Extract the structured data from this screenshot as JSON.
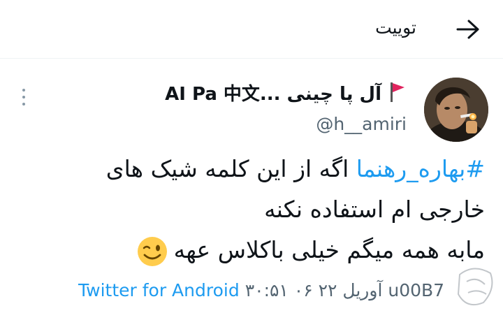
{
  "header": {
    "title": "توییت",
    "back_icon": "arrow-left-icon"
  },
  "tweet": {
    "author": {
      "display_name": "AI Pa 中文... آل پا چینی",
      "handle": "@h__amiri",
      "flag_icon": "triangular-flag-icon",
      "avatar_icon": "avatar-image"
    },
    "more_icon": "vertical-ellipsis-icon",
    "text": {
      "hashtag": "#بهاره_رهنما",
      "line1_rest": " اگه از این کلمه شیک های",
      "line2": "خارجی ام استفاده نکنه",
      "line3": "مابه همه میگم خیلی باکلاس عهه",
      "emoji": "winking-face-emoji"
    },
    "meta": {
      "timestamp": "۳۰:۵۱ ۰۶ آوریل ۲۲ u00B7",
      "source": "Twitter for Android"
    }
  },
  "colors": {
    "accent": "#1d9bf0",
    "secondary_text": "#536471",
    "flag": "#e0245e"
  }
}
